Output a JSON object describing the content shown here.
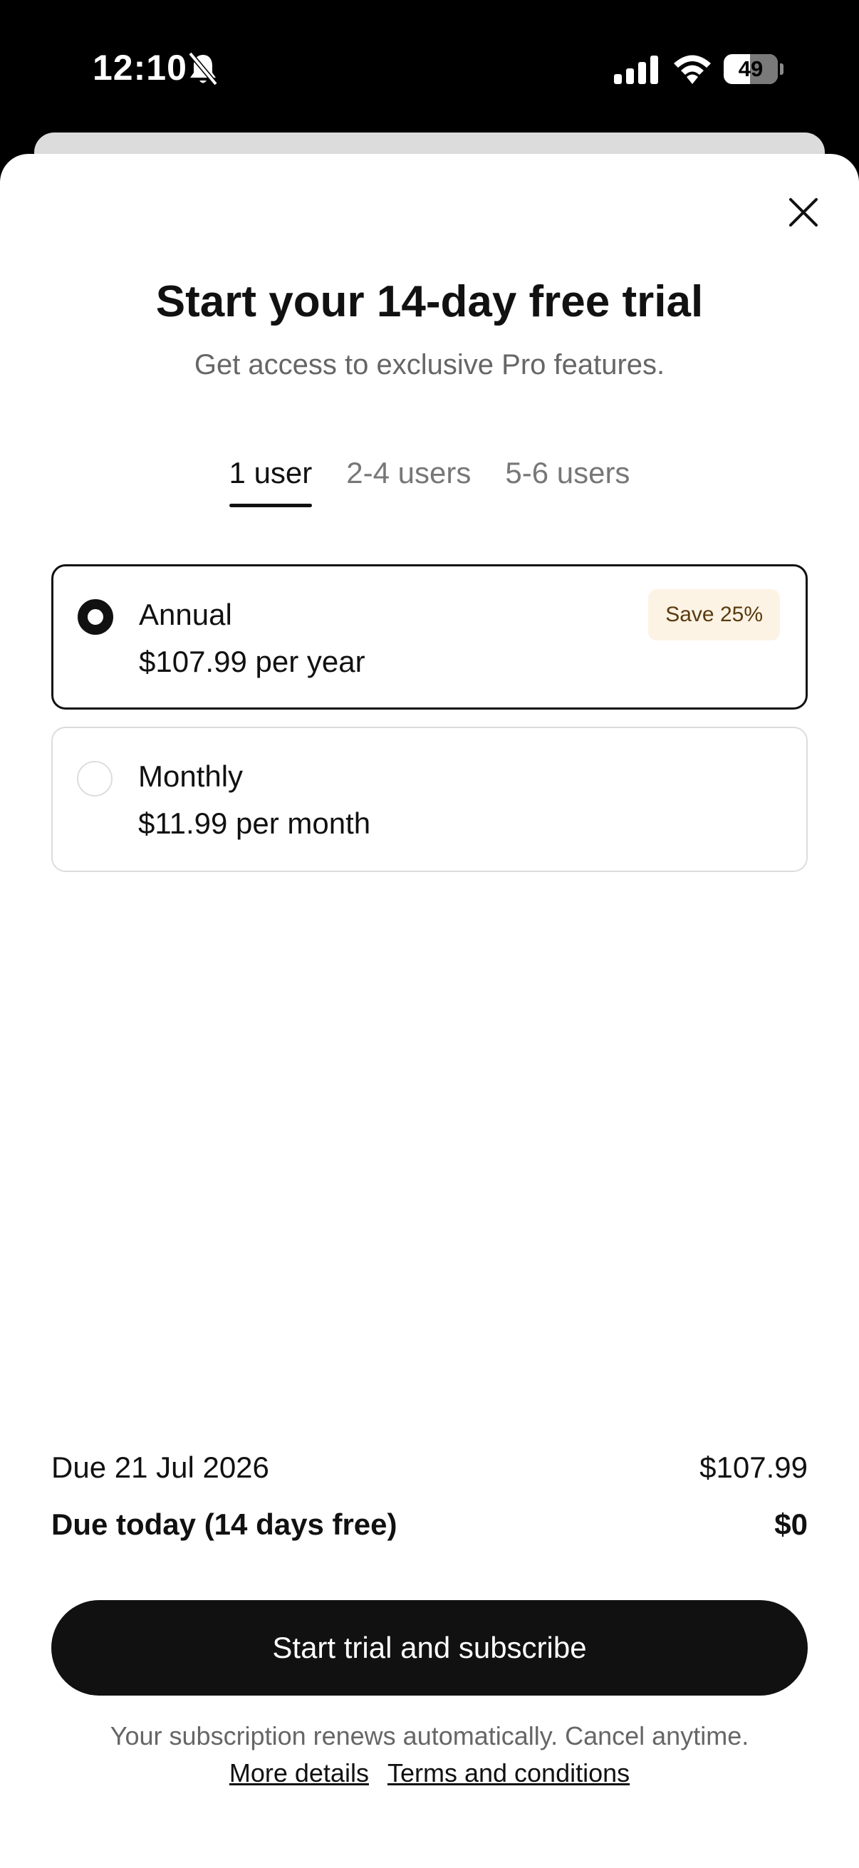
{
  "status_bar": {
    "time": "12:10",
    "battery": "49",
    "icons": [
      "bell-slash-icon",
      "cellular-signal-icon",
      "wifi-icon",
      "battery-icon"
    ]
  },
  "sheet": {
    "close_icon": "close-icon",
    "title": "Start your 14-day free trial",
    "subtitle": "Get access to exclusive Pro features."
  },
  "tabs": [
    {
      "label": "1 user",
      "active": true
    },
    {
      "label": "2-4 users",
      "active": false
    },
    {
      "label": "5-6 users",
      "active": false
    }
  ],
  "plans": {
    "annual": {
      "name": "Annual",
      "price": "$107.99 per year",
      "badge": "Save 25%",
      "selected": true
    },
    "monthly": {
      "name": "Monthly",
      "price": "$11.99 per month",
      "selected": false
    }
  },
  "summary": {
    "due_later_label": "Due 21 Jul 2026",
    "due_later_value": "$107.99",
    "due_today_label": "Due today (14 days free)",
    "due_today_value": "$0"
  },
  "cta": {
    "label": "Start trial and subscribe"
  },
  "footer": {
    "note": "Your subscription renews automatically. Cancel anytime.",
    "link_details": "More details",
    "link_terms": "Terms and conditions"
  },
  "colors": {
    "primary": "#111111",
    "badge_bg": "#fdf3e4",
    "muted_text": "#666666"
  }
}
